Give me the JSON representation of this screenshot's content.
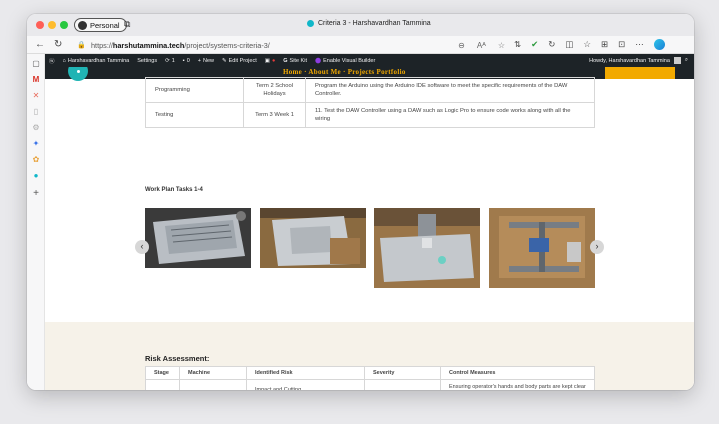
{
  "browser": {
    "profile_label": "Personal",
    "tab_title": "Criteria 3 - Harshavardhan Tammina",
    "url_prefix": "https://",
    "url_domain": "harshutammina.tech",
    "url_path": "/project/systems-criteria-3/"
  },
  "wp_admin_bar": {
    "site_name": "Harshavardhan Tammina",
    "settings": "Settings",
    "updates_count": "1",
    "comments_count": "0",
    "new": "New",
    "edit_project": "Edit Project",
    "site_kit": "Site Kit",
    "visual_builder": "Enable Visual Builder",
    "howdy": "Howdy, Harshavardhan Tammina"
  },
  "site_header": {
    "menu_text": "Home · About Me · Projects Portfolio"
  },
  "work_plan": {
    "rows": [
      {
        "task": "Programming",
        "timing": "Term 2 School Holidays",
        "description": "Program the Arduino using the Arduino IDE software to meet the specific requirements of the DAW Controller."
      },
      {
        "task": "Testing",
        "timing": "Term 3 Week 1",
        "description": "11. Test the DAW Controller using a DAW such as Logic Pro to ensure code works along with all the wiring"
      }
    ]
  },
  "gallery": {
    "title": "Work Plan Tasks 1-4"
  },
  "risk": {
    "title": "Risk Assessment:",
    "headers": [
      "Stage",
      "Machine",
      "Identified Risk",
      "Severity",
      "Control Measures"
    ],
    "rows": [
      {
        "stage": "",
        "machine": "",
        "risk": "Impact and Cutting",
        "severity": "",
        "control": "Ensuring operator's hands and body parts are kept clear of moving parts"
      }
    ]
  },
  "colors": {
    "accent_orange": "#f2a900",
    "logo_teal": "#20b4b4",
    "admin_bar": "#1d2327",
    "risk_section_bg": "#f6f2e9"
  }
}
